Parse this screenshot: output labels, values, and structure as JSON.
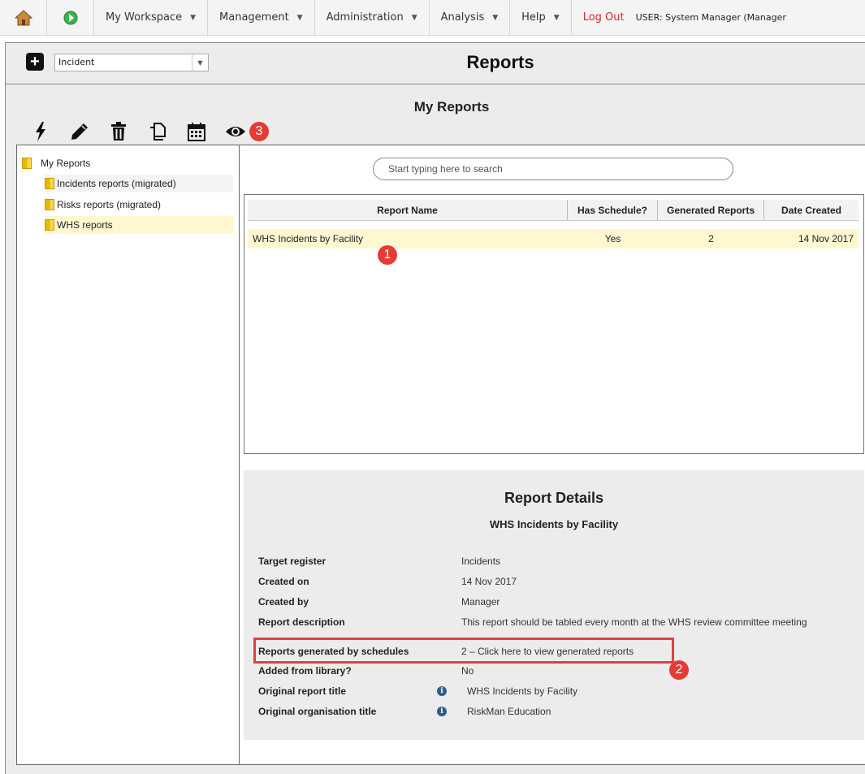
{
  "nav": {
    "menus": [
      "My Workspace",
      "Management",
      "Administration",
      "Analysis",
      "Help"
    ],
    "logout": "Log Out",
    "user": "USER: System Manager (Manager"
  },
  "header": {
    "register_select": "Incident",
    "title": "Reports"
  },
  "panel": {
    "subtitle": "My Reports",
    "toolbar_icons": [
      "run-icon",
      "edit-icon",
      "delete-icon",
      "copy-icon",
      "schedule-icon",
      "view-icon"
    ],
    "badge3": "3"
  },
  "tree": {
    "root": "My Reports",
    "items": [
      "Incidents reports (migrated)",
      "Risks reports (migrated)",
      "WHS reports"
    ]
  },
  "search": {
    "placeholder": "Start typing here to search"
  },
  "grid": {
    "columns": [
      "Report Name",
      "Has Schedule?",
      "Generated Reports",
      "Date Created"
    ],
    "rows": [
      {
        "name": "WHS Incidents by Facility",
        "has_schedule": "Yes",
        "generated": "2",
        "date": "14 Nov 2017"
      }
    ],
    "badge1": "1"
  },
  "details": {
    "title": "Report Details",
    "subtitle": "WHS Incidents by Facility",
    "fields": [
      {
        "label": "Target register",
        "value": "Incidents"
      },
      {
        "label": "Created on",
        "value": "14 Nov 2017"
      },
      {
        "label": "Created by",
        "value": "Manager"
      },
      {
        "label": "Report description",
        "value": "This report should be tabled every month at the WHS review committee meeting"
      },
      {
        "label": "Reports generated by schedules",
        "value": "2   – Click here to view generated reports"
      },
      {
        "label": "Added from library?",
        "value": "No"
      },
      {
        "label": "Original report title",
        "value": "WHS Incidents by Facility"
      },
      {
        "label": "Original organisation title",
        "value": "RiskMan Education"
      }
    ],
    "badge2": "2"
  }
}
